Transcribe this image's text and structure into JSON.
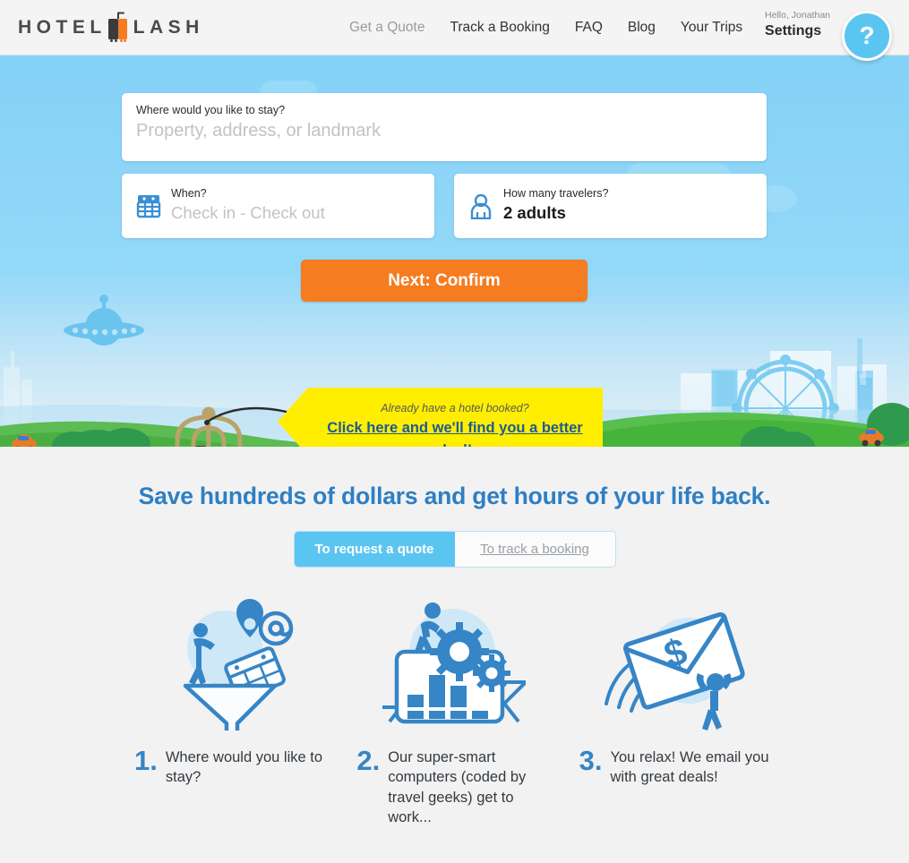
{
  "header": {
    "logo": {
      "text_left": "HOTEL",
      "text_right": "LASH",
      "icon": "suitcase-icon",
      "accent_color": "#f57c20"
    },
    "nav": [
      {
        "label": "Get a Quote",
        "muted": true
      },
      {
        "label": "Track a Booking",
        "muted": false
      },
      {
        "label": "FAQ",
        "muted": false
      },
      {
        "label": "Blog",
        "muted": false
      },
      {
        "label": "Your Trips",
        "muted": false
      }
    ],
    "account": {
      "greeting": "Hello, Jonathan",
      "settings_label": "Settings"
    },
    "help_button": {
      "label": "?",
      "icon": "question-mark-icon",
      "color": "#5bc5f2"
    }
  },
  "hero": {
    "background_color": "#84d2f7",
    "search": {
      "destination": {
        "label": "Where would you like to stay?",
        "placeholder": "Property, address, or landmark",
        "value": ""
      },
      "dates": {
        "label": "When?",
        "placeholder": "Check in - Check out",
        "value": "",
        "icon": "calendar-icon"
      },
      "travelers": {
        "label": "How many travelers?",
        "value": "2 adults",
        "icon": "person-icon"
      },
      "submit_label": "Next: Confirm",
      "submit_color": "#f57c20"
    },
    "banner": {
      "subtitle": "Already have a hotel booked?",
      "link_text": "Click here and we'll find you a better deal!",
      "background_color": "#ffee00",
      "link_color": "#1d5a97"
    },
    "illustration": {
      "cart": "luggage-cart-icon",
      "ufo": "ufo-icon",
      "ferris_wheel": "ferris-wheel-icon",
      "cars": 2
    }
  },
  "lower": {
    "headline": "Save hundreds of dollars and get hours of your life back.",
    "headline_color": "#2e7fc4",
    "toggle": {
      "active_index": 0,
      "tabs": [
        {
          "label": "To request a quote"
        },
        {
          "label": "To track a booking"
        }
      ]
    },
    "steps": [
      {
        "number": "1.",
        "text": "Where would you like to stay?",
        "icon": "funnel-search-icon"
      },
      {
        "number": "2.",
        "text": "Our super-smart computers (coded by travel geeks) get to work...",
        "icon": "gears-chart-icon"
      },
      {
        "number": "3.",
        "text": "You relax! We email you with great deals!",
        "icon": "envelope-dollar-icon"
      }
    ]
  }
}
